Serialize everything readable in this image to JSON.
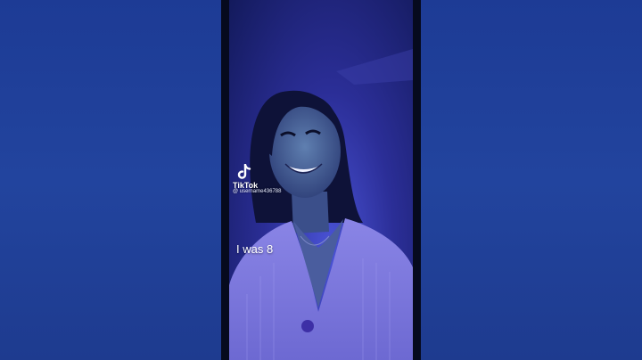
{
  "video": {
    "watermark_brand": "TikTok",
    "watermark_user": "@ username436788",
    "caption": "I was 8"
  },
  "colors": {
    "background": "#1f3a8f",
    "letterbox": "#060a1e",
    "video_tint": "#2b2e97"
  },
  "icons": [
    "tiktok-logo-icon"
  ]
}
